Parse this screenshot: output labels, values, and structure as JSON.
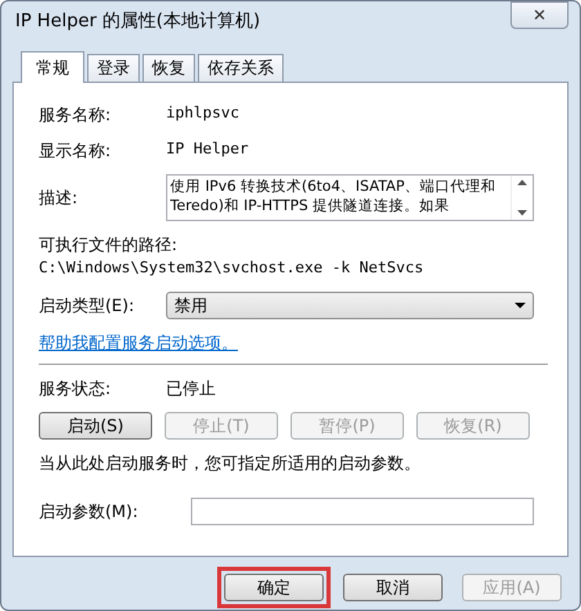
{
  "window": {
    "title": "IP Helper 的属性(本地计算机)",
    "close": "✕"
  },
  "tabs": [
    {
      "label": "常规",
      "selected": true
    },
    {
      "label": "登录",
      "selected": false
    },
    {
      "label": "恢复",
      "selected": false
    },
    {
      "label": "依存关系",
      "selected": false
    }
  ],
  "service_name": {
    "label": "服务名称:",
    "value": "iphlpsvc"
  },
  "display_name": {
    "label": "显示名称:",
    "value": "IP Helper"
  },
  "description": {
    "label": "描述:",
    "value": "使用 IPv6 转换技术(6to4、ISATAP、端口代理和 Teredo)和 IP-HTTPS 提供隧道连接。如果"
  },
  "path": {
    "label": "可执行文件的路径:",
    "value": "C:\\Windows\\System32\\svchost.exe -k NetSvcs"
  },
  "startup_type": {
    "label": "启动类型(E):",
    "value": "禁用"
  },
  "help_link": "帮助我配置服务启动选项。",
  "status": {
    "label": "服务状态:",
    "value": "已停止"
  },
  "service_buttons": [
    {
      "label": "启动(S)",
      "disabled": false
    },
    {
      "label": "停止(T)",
      "disabled": true
    },
    {
      "label": "暂停(P)",
      "disabled": true
    },
    {
      "label": "恢复(R)",
      "disabled": true
    }
  ],
  "hint": "当从此处启动服务时，您可指定所适用的启动参数。",
  "start_params": {
    "label": "启动参数(M):"
  },
  "dialog_buttons": [
    {
      "label": "确定",
      "highlighted": true,
      "disabled": false
    },
    {
      "label": "取消",
      "highlighted": false,
      "disabled": false
    },
    {
      "label": "应用(A)",
      "highlighted": false,
      "disabled": true
    }
  ]
}
